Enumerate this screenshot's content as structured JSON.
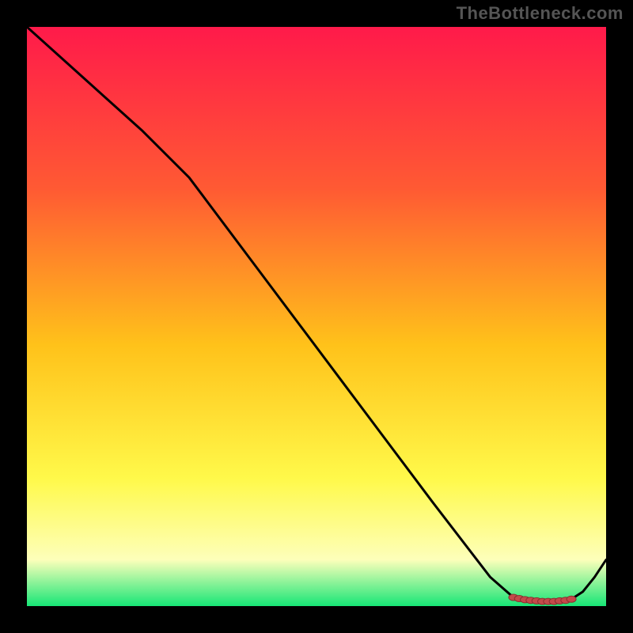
{
  "watermark": "TheBottleneck.com",
  "colors": {
    "background": "#000000",
    "gradient_top": "#ff1a4a",
    "gradient_upper_mid": "#ff5a33",
    "gradient_mid": "#ffc21a",
    "gradient_lower_mid": "#fff94a",
    "gradient_pale": "#fdffba",
    "gradient_bottom": "#17e676",
    "curve": "#000000",
    "marker_fill": "#c44a4a",
    "marker_stroke": "#8a2f2f"
  },
  "chart_data": {
    "type": "line",
    "title": "",
    "xlabel": "",
    "ylabel": "",
    "xlim": [
      0,
      100
    ],
    "ylim": [
      0,
      100
    ],
    "series": [
      {
        "name": "curve",
        "x": [
          0,
          10,
          20,
          28,
          40,
          55,
          70,
          80,
          84,
          86,
          88,
          89,
          90,
          91,
          92,
          93,
          94,
          96,
          98,
          100
        ],
        "y": [
          100,
          91,
          82,
          74,
          58,
          38,
          18,
          5,
          1.5,
          1.1,
          0.9,
          0.8,
          0.8,
          0.8,
          0.9,
          1.0,
          1.2,
          2.5,
          5.0,
          8.0
        ]
      }
    ],
    "markers": {
      "name": "optimal-range",
      "x": [
        84,
        85,
        86,
        87,
        88,
        89,
        90,
        91,
        92,
        93,
        94
      ],
      "y": [
        1.5,
        1.3,
        1.1,
        1.0,
        0.9,
        0.8,
        0.8,
        0.8,
        0.9,
        1.0,
        1.2
      ]
    }
  }
}
